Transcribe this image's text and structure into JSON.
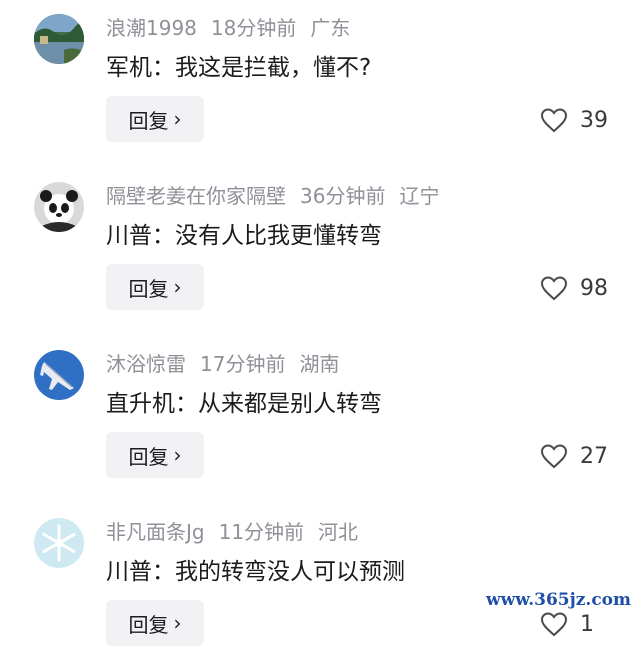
{
  "comments": [
    {
      "username": "浪潮1998",
      "time": "18分钟前",
      "location": "广东",
      "text": "军机：我这是拦截，懂不?",
      "reply_label": "回复",
      "likes": "39",
      "avatar_icon": "lake-scenery-avatar"
    },
    {
      "username": "隔壁老姜在你家隔壁",
      "time": "36分钟前",
      "location": "辽宁",
      "text": "川普：没有人比我更懂转弯",
      "reply_label": "回复",
      "likes": "98",
      "avatar_icon": "panda-avatar"
    },
    {
      "username": "沐浴惊雷",
      "time": "17分钟前",
      "location": "湖南",
      "text": "直升机：从来都是别人转弯",
      "reply_label": "回复",
      "likes": "27",
      "avatar_icon": "fighter-jet-avatar"
    },
    {
      "username": "非凡面条Jg",
      "time": "11分钟前",
      "location": "河北",
      "text": "川普：我的转弯没人可以预测",
      "reply_label": "回复",
      "likes": "1",
      "avatar_icon": "snowflake-avatar"
    }
  ],
  "watermark": "www.365jz.com",
  "colors": {
    "meta_text": "#8f9198",
    "body_text": "#1c1c1e",
    "reply_bg": "#f2f2f4",
    "watermark": "#1f4fa8"
  }
}
